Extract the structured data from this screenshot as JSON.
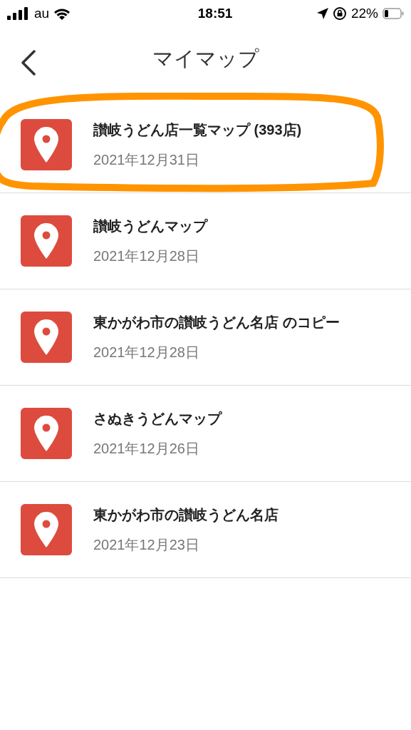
{
  "status_bar": {
    "carrier": "au",
    "time": "18:51",
    "battery": "22%"
  },
  "header": {
    "title": "マイマップ"
  },
  "maps": [
    {
      "title": "讃岐うどん店一覧マップ (393店)",
      "date": "2021年12月31日",
      "highlighted": true
    },
    {
      "title": "讃岐うどんマップ",
      "date": "2021年12月28日",
      "highlighted": false
    },
    {
      "title": "東かがわ市の讃岐うどん名店 のコピー",
      "date": "2021年12月28日",
      "highlighted": false
    },
    {
      "title": "さぬきうどんマップ",
      "date": "2021年12月26日",
      "highlighted": false
    },
    {
      "title": "東かがわ市の讃岐うどん名店",
      "date": "2021年12月23日",
      "highlighted": false
    }
  ]
}
